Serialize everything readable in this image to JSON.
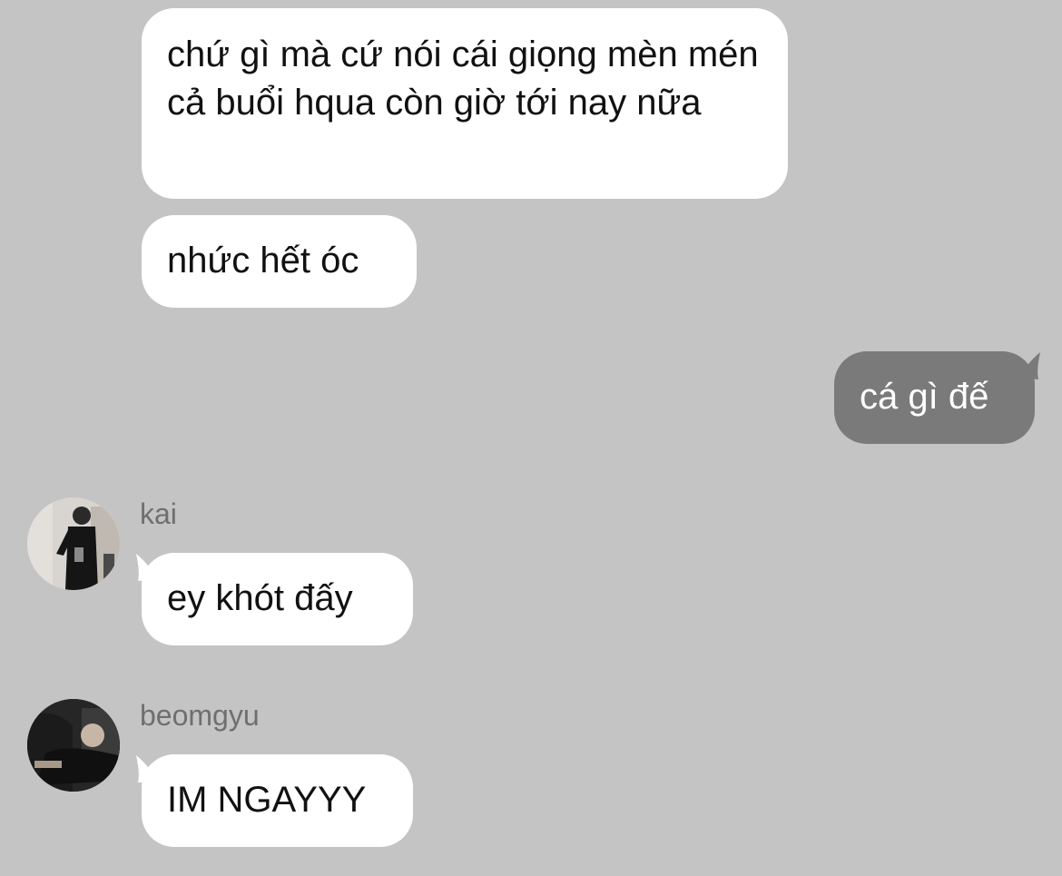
{
  "messages": {
    "m1": "chứ gì mà cứ nói cái giọng mèn mén cả buổi hqua còn giờ tới nay nữa",
    "m2": "nhức hết óc",
    "m3": "cá gì đế",
    "m4": "ey khót đấy",
    "m5": "IM NGAYYY"
  },
  "senders": {
    "kai": "kai",
    "beomgyu": "beomgyu"
  },
  "colors": {
    "background": "#c4c4c4",
    "incoming_bubble": "#ffffff",
    "outgoing_bubble": "#7a7a7a",
    "sender_name": "#6f6f6f"
  },
  "icons": {
    "kai_avatar": "avatar-photo",
    "beomgyu_avatar": "avatar-photo"
  }
}
